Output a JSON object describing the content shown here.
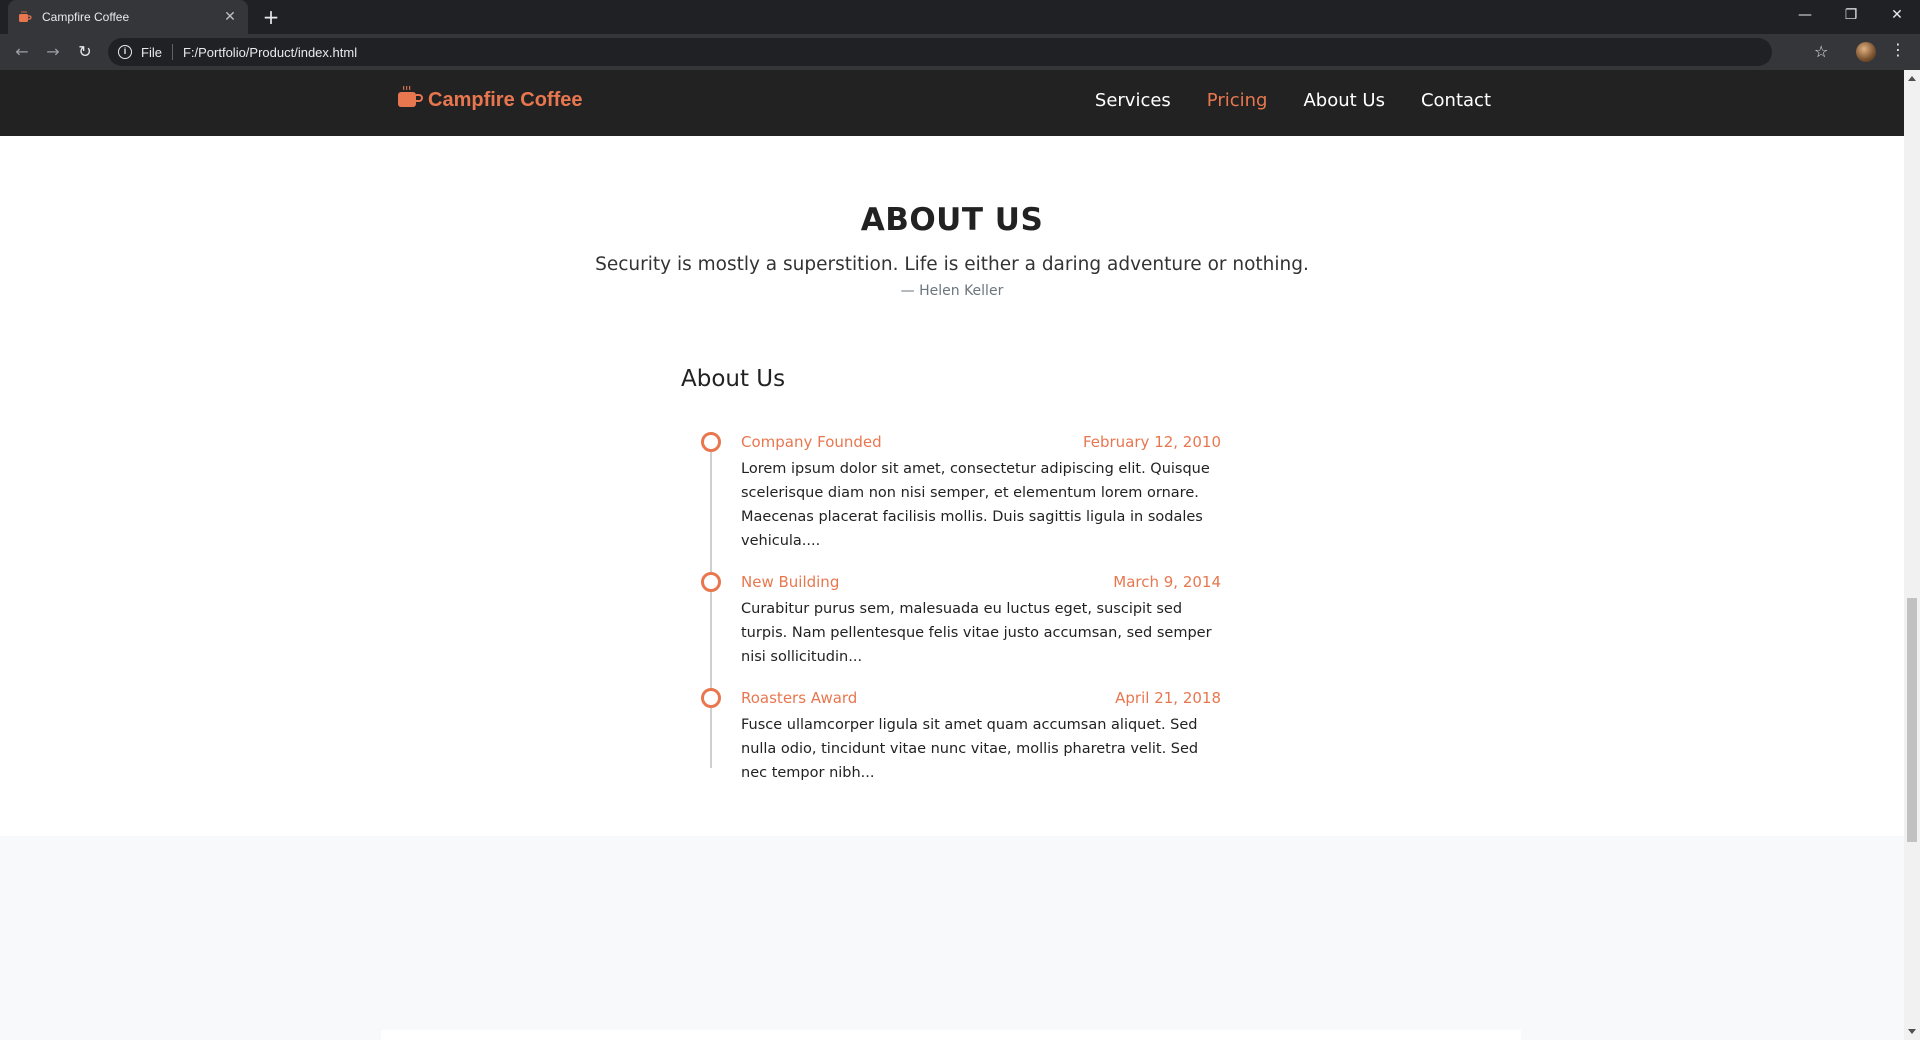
{
  "browser": {
    "tab_title": "Campfire Coffee",
    "url_scheme": "File",
    "url": "F:/Portfolio/Product/index.html"
  },
  "nav": {
    "brand": "Campfire Coffee",
    "items": [
      {
        "label": "Services",
        "active": false
      },
      {
        "label": "Pricing",
        "active": true
      },
      {
        "label": "About Us",
        "active": false
      },
      {
        "label": "Contact",
        "active": false
      }
    ]
  },
  "about": {
    "title": "ABOUT US",
    "quote": "Security is mostly a superstition. Life is either a daring adventure or nothing.",
    "author": "— Helen Keller",
    "timeline_heading": "About Us",
    "events": [
      {
        "title": "Company Founded",
        "date": "February 12, 2010",
        "text": "Lorem ipsum dolor sit amet, consectetur adipiscing elit. Quisque scelerisque diam non nisi semper, et elementum lorem ornare. Maecenas placerat facilisis mollis. Duis sagittis ligula in sodales vehicula...."
      },
      {
        "title": "New Building",
        "date": "March 9, 2014",
        "text": "Curabitur purus sem, malesuada eu luctus eget, suscipit sed turpis. Nam pellentesque felis vitae justo accumsan, sed semper nisi sollicitudin..."
      },
      {
        "title": "Roasters Award",
        "date": "April 21, 2018",
        "text": "Fusce ullamcorper ligula sit amet quam accumsan aliquet. Sed nulla odio, tincidunt vitae nunc vitae, mollis pharetra velit. Sed nec tempor nibh..."
      }
    ]
  },
  "colors": {
    "accent": "#e8774f",
    "nav_bg": "#222222"
  },
  "icons": {
    "favicon": "coffee-cup-icon",
    "logo": "coffee-cup-icon"
  }
}
